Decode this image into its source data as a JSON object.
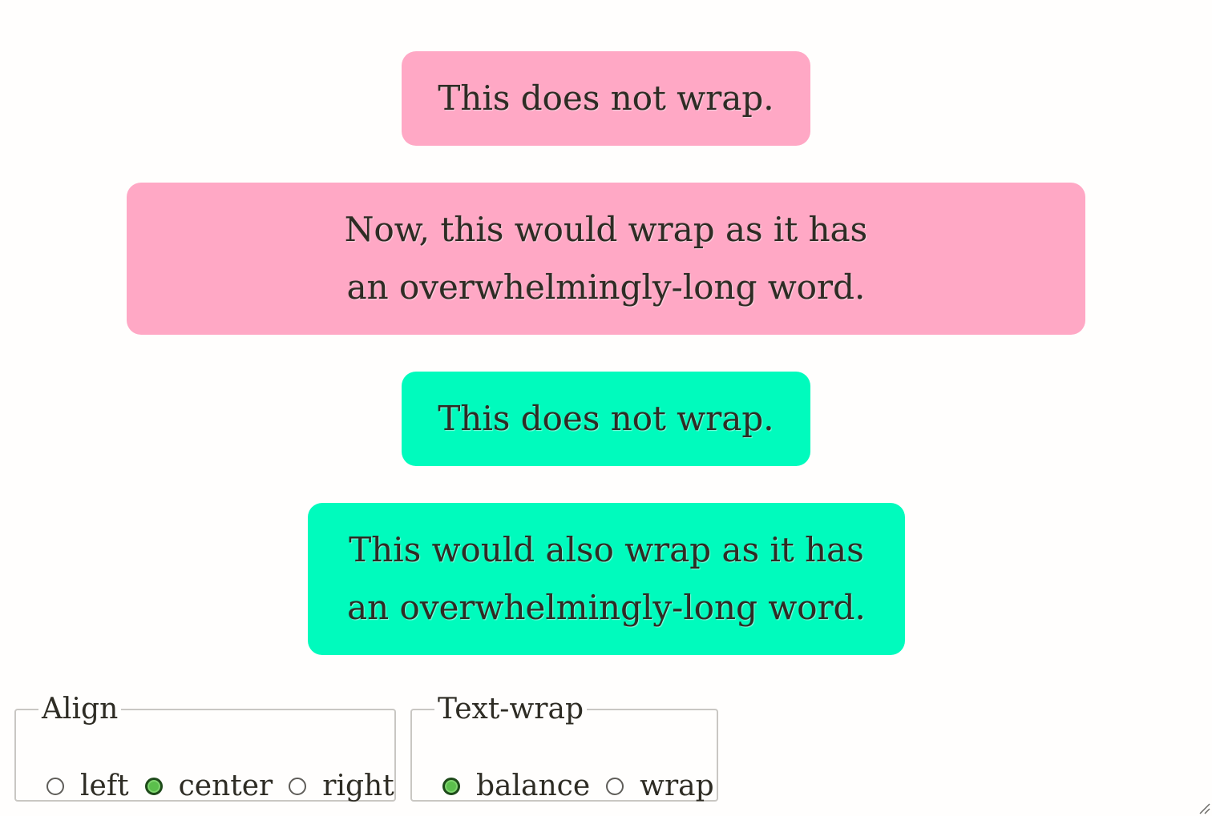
{
  "boxes": [
    {
      "lines": [
        "This does not wrap."
      ],
      "color": "#ffa8c5"
    },
    {
      "lines": [
        "Now, this would wrap as it has",
        "an overwhelmingly-long word."
      ],
      "color": "#ffa8c5"
    },
    {
      "lines": [
        "This does not wrap."
      ],
      "color": "#00fbbd"
    },
    {
      "lines": [
        "This would also wrap as it has",
        "an overwhelmingly-long word."
      ],
      "color": "#00fbbd"
    }
  ],
  "align": {
    "legend": "Align",
    "options": [
      "left",
      "center",
      "right"
    ],
    "selected": "center"
  },
  "text_wrap": {
    "legend": "Text-wrap",
    "options": [
      "balance",
      "wrap"
    ],
    "selected": "balance"
  },
  "colors": {
    "pink": "#ffa8c5",
    "green": "#00fbbd",
    "radio_checked": "#5bbf4c"
  },
  "icons": {
    "resize": "resize-handle-icon"
  }
}
